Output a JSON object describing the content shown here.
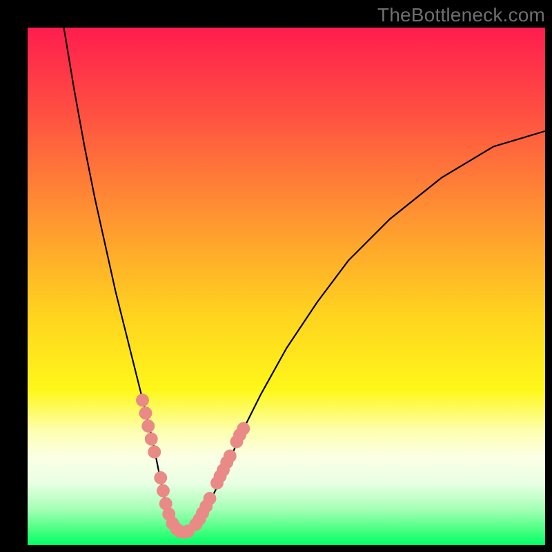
{
  "watermark": "TheBottleneck.com",
  "chart_data": {
    "type": "line",
    "title": "",
    "xlabel": "",
    "ylabel": "",
    "xlim": [
      0,
      100
    ],
    "ylim": [
      0,
      100
    ],
    "grid": false,
    "series": [
      {
        "name": "bottleneck-curve",
        "x": [
          7,
          9,
          11,
          13,
          15,
          17,
          19,
          21,
          23,
          24,
          25,
          26,
          27,
          28.5,
          30,
          31,
          33,
          35,
          38,
          41,
          45,
          50,
          56,
          62,
          70,
          80,
          90,
          100
        ],
        "y": [
          100,
          88,
          77,
          67,
          58,
          49,
          41,
          33,
          25,
          21,
          16,
          11,
          7,
          4,
          2.5,
          2.5,
          4,
          8,
          14,
          21,
          29,
          38,
          47,
          55,
          63,
          71,
          77,
          80
        ],
        "stroke": "#000000",
        "stroke_width": 2.2
      }
    ],
    "markers": {
      "name": "dense-highlight-dots",
      "fill": "#e98a86",
      "radius": 9,
      "points": [
        {
          "x": 22.2,
          "y": 28
        },
        {
          "x": 22.8,
          "y": 25.5
        },
        {
          "x": 23.3,
          "y": 23
        },
        {
          "x": 23.9,
          "y": 20.5
        },
        {
          "x": 24.5,
          "y": 18
        },
        {
          "x": 25.7,
          "y": 13
        },
        {
          "x": 26.2,
          "y": 10.5
        },
        {
          "x": 26.7,
          "y": 8
        },
        {
          "x": 27.3,
          "y": 6
        },
        {
          "x": 28.0,
          "y": 4.2
        },
        {
          "x": 28.8,
          "y": 3.1
        },
        {
          "x": 29.5,
          "y": 2.6
        },
        {
          "x": 30.3,
          "y": 2.5
        },
        {
          "x": 31.0,
          "y": 2.7
        },
        {
          "x": 32.5,
          "y": 4.0
        },
        {
          "x": 33.2,
          "y": 5.0
        },
        {
          "x": 33.8,
          "y": 6.2
        },
        {
          "x": 34.5,
          "y": 7.5
        },
        {
          "x": 35.2,
          "y": 9.0
        },
        {
          "x": 36.6,
          "y": 12.0
        },
        {
          "x": 37.2,
          "y": 13.3
        },
        {
          "x": 37.8,
          "y": 14.5
        },
        {
          "x": 38.5,
          "y": 16.0
        },
        {
          "x": 39.1,
          "y": 17.2
        },
        {
          "x": 40.4,
          "y": 20.0
        },
        {
          "x": 41.0,
          "y": 21.3
        },
        {
          "x": 41.7,
          "y": 22.5
        }
      ]
    },
    "background_gradient": {
      "direction": "top-to-bottom",
      "stops": [
        {
          "offset": 0.0,
          "color": "#ff1d4e"
        },
        {
          "offset": 0.15,
          "color": "#ff4b43"
        },
        {
          "offset": 0.35,
          "color": "#ff8f33"
        },
        {
          "offset": 0.55,
          "color": "#ffd21f"
        },
        {
          "offset": 0.7,
          "color": "#fff71a"
        },
        {
          "offset": 0.78,
          "color": "#fdffb0"
        },
        {
          "offset": 0.83,
          "color": "#fbffe5"
        },
        {
          "offset": 0.88,
          "color": "#e9ffe3"
        },
        {
          "offset": 0.93,
          "color": "#a6ffb7"
        },
        {
          "offset": 0.97,
          "color": "#4bff82"
        },
        {
          "offset": 1.0,
          "color": "#00ff66"
        }
      ]
    }
  }
}
